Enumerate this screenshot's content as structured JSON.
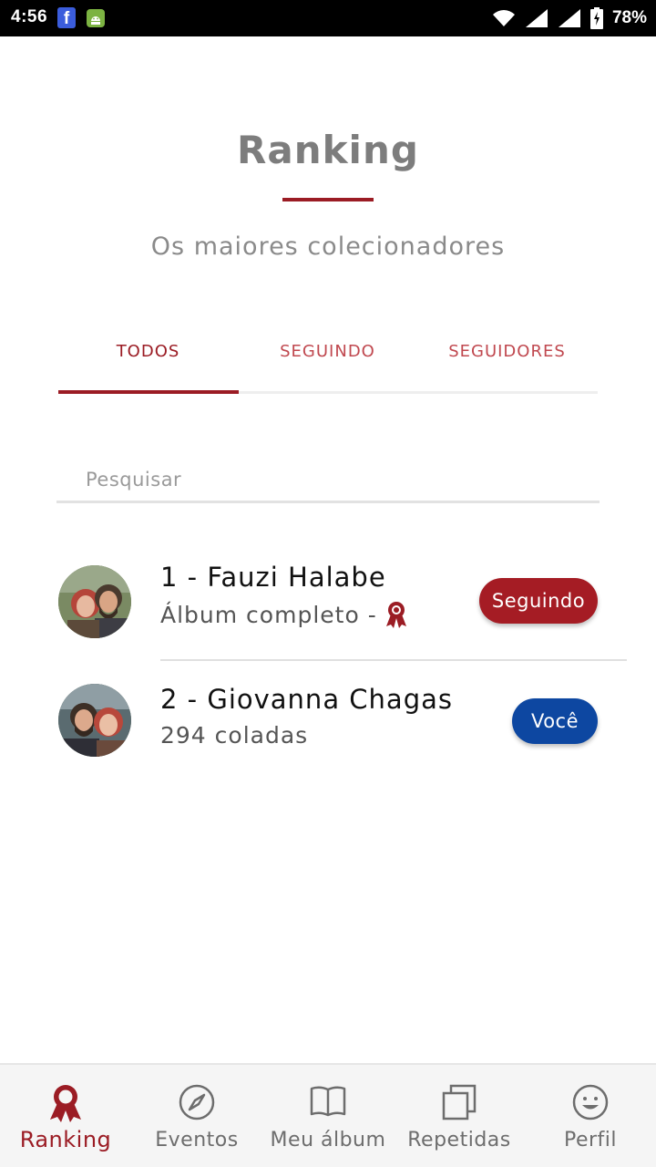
{
  "status_bar": {
    "time": "4:56",
    "battery": "78%"
  },
  "header": {
    "title": "Ranking",
    "subtitle": "Os maiores colecionadores"
  },
  "tabs": [
    {
      "label": "TODOS",
      "active": true
    },
    {
      "label": "SEGUINDO",
      "active": false
    },
    {
      "label": "SEGUIDORES",
      "active": false
    }
  ],
  "search": {
    "placeholder": "Pesquisar",
    "value": ""
  },
  "ranking": [
    {
      "name": "1 - Fauzi Halabe",
      "subtitle": "Álbum completo -",
      "badge_icon": "ribbon-award-icon",
      "button_label": "Seguindo",
      "button_color": "#a51c24"
    },
    {
      "name": "2 - Giovanna Chagas",
      "subtitle": "294 coladas",
      "button_label": "Você",
      "button_color": "#0d47a1"
    }
  ],
  "bottom_nav": [
    {
      "label": "Ranking",
      "icon": "award-icon",
      "active": true
    },
    {
      "label": "Eventos",
      "icon": "compass-icon",
      "active": false
    },
    {
      "label": "Meu álbum",
      "icon": "book-icon",
      "active": false
    },
    {
      "label": "Repetidas",
      "icon": "copy-icon",
      "active": false
    },
    {
      "label": "Perfil",
      "icon": "smiley-icon",
      "active": false
    }
  ],
  "colors": {
    "primary": "#9b1c24",
    "secondary": "#0d47a1",
    "muted": "#8a8a8a"
  }
}
